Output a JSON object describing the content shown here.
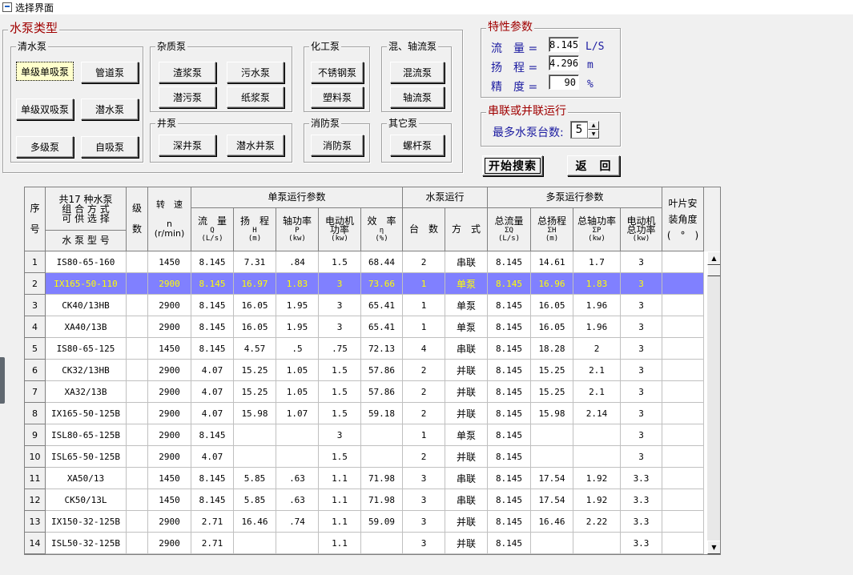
{
  "window": {
    "title": "选择界面"
  },
  "pump_type": {
    "legend": "水泵类型",
    "clean": {
      "legend": "清水泵",
      "buttons": [
        "单级单吸泵",
        "管道泵",
        "单级双吸泵",
        "潜水泵",
        "多级泵",
        "自吸泵"
      ]
    },
    "impurity": {
      "legend": "杂质泵",
      "buttons": [
        "渣浆泵",
        "污水泵",
        "潜污泵",
        "纸浆泵"
      ]
    },
    "chemical": {
      "legend": "化工泵",
      "buttons": [
        "不锈钢泵",
        "塑料泵"
      ]
    },
    "mixed": {
      "legend": "混、轴流泵",
      "buttons": [
        "混流泵",
        "轴流泵"
      ]
    },
    "well": {
      "legend": "井泵",
      "buttons": [
        "深井泵",
        "潜水井泵"
      ]
    },
    "fire": {
      "legend": "消防泵",
      "buttons": [
        "消防泵"
      ]
    },
    "other": {
      "legend": "其它泵",
      "buttons": [
        "螺杆泵"
      ]
    }
  },
  "characteristics": {
    "legend": "特性参数",
    "flow": {
      "label": "流　量 =",
      "value": "8.145",
      "unit": "L/S"
    },
    "head": {
      "label": "扬　程 =",
      "value": "4.296",
      "unit": "m"
    },
    "accuracy": {
      "label": "精　度 =",
      "value": "90",
      "unit": "%"
    }
  },
  "series_parallel": {
    "legend": "串联或并联运行",
    "max_label": "最多水泵台数:",
    "max_value": "5"
  },
  "actions": {
    "search": "开始搜索",
    "back": "返　回"
  },
  "table": {
    "headers": {
      "seq": "序\n\n号",
      "combo": "共17 种水泵\n组 合 方 式\n可 供 选 择",
      "model": "水 泵 型 号",
      "stage": "级\n\n数",
      "speed": "转　速\n\nn\n(r/min)",
      "single_group": "单泵运行参数",
      "flow": "流　量",
      "flow_sub": "Q\n(L/s)",
      "head": "扬　程",
      "head_sub": "H\n(m)",
      "shaft": "轴功率",
      "shaft_sub": "P\n(kw)",
      "motor": "电动机\n功率",
      "motor_sub": "(kw)",
      "eff": "效　率",
      "eff_sub": "η\n(%)",
      "run_group": "水泵运行",
      "count": "台　数",
      "mode": "方　式",
      "multi_group": "多泵运行参数",
      "tflow": "总流量",
      "tflow_sub": "ΣQ\n(L/s)",
      "thead": "总扬程",
      "thead_sub": "ΣH\n(m)",
      "tshaft": "总轴功率",
      "tshaft_sub": "ΣP\n(kw)",
      "tmotor": "电动机\n总功率",
      "tmotor_sub": "(kw)",
      "blade": "叶片安\n装角度\n(　°　)"
    },
    "rows": [
      [
        "1",
        "IS80-65-160",
        "",
        "1450",
        "8.145",
        "7.31",
        ".84",
        "1.5",
        "68.44",
        "2",
        "串联",
        "8.145",
        "14.61",
        "1.7",
        "3",
        ""
      ],
      [
        "2",
        "IX165-50-110",
        "",
        "2900",
        "8.145",
        "16.97",
        "1.83",
        "3",
        "73.66",
        "1",
        "单泵",
        "8.145",
        "16.96",
        "1.83",
        "3",
        ""
      ],
      [
        "3",
        "CK40/13HB",
        "",
        "2900",
        "8.145",
        "16.05",
        "1.95",
        "3",
        "65.41",
        "1",
        "单泵",
        "8.145",
        "16.05",
        "1.96",
        "3",
        ""
      ],
      [
        "4",
        "XA40/13B",
        "",
        "2900",
        "8.145",
        "16.05",
        "1.95",
        "3",
        "65.41",
        "1",
        "单泵",
        "8.145",
        "16.05",
        "1.96",
        "3",
        ""
      ],
      [
        "5",
        "IS80-65-125",
        "",
        "1450",
        "8.145",
        "4.57",
        ".5",
        ".75",
        "72.13",
        "4",
        "串联",
        "8.145",
        "18.28",
        "2",
        "3",
        ""
      ],
      [
        "6",
        "CK32/13HB",
        "",
        "2900",
        "4.07",
        "15.25",
        "1.05",
        "1.5",
        "57.86",
        "2",
        "并联",
        "8.145",
        "15.25",
        "2.1",
        "3",
        ""
      ],
      [
        "7",
        "XA32/13B",
        "",
        "2900",
        "4.07",
        "15.25",
        "1.05",
        "1.5",
        "57.86",
        "2",
        "并联",
        "8.145",
        "15.25",
        "2.1",
        "3",
        ""
      ],
      [
        "8",
        "IX165-50-125B",
        "",
        "2900",
        "4.07",
        "15.98",
        "1.07",
        "1.5",
        "59.18",
        "2",
        "并联",
        "8.145",
        "15.98",
        "2.14",
        "3",
        ""
      ],
      [
        "9",
        "ISL80-65-125B",
        "",
        "2900",
        "8.145",
        "",
        "",
        "3",
        "",
        "1",
        "单泵",
        "8.145",
        "",
        "",
        "3",
        ""
      ],
      [
        "10",
        "ISL65-50-125B",
        "",
        "2900",
        "4.07",
        "",
        "",
        "1.5",
        "",
        "2",
        "并联",
        "8.145",
        "",
        "",
        "3",
        ""
      ],
      [
        "11",
        "XA50/13",
        "",
        "1450",
        "8.145",
        "5.85",
        ".63",
        "1.1",
        "71.98",
        "3",
        "串联",
        "8.145",
        "17.54",
        "1.92",
        "3.3",
        ""
      ],
      [
        "12",
        "CK50/13L",
        "",
        "1450",
        "8.145",
        "5.85",
        ".63",
        "1.1",
        "71.98",
        "3",
        "串联",
        "8.145",
        "17.54",
        "1.92",
        "3.3",
        ""
      ],
      [
        "13",
        "IX150-32-125B",
        "",
        "2900",
        "2.71",
        "16.46",
        ".74",
        "1.1",
        "59.09",
        "3",
        "并联",
        "8.145",
        "16.46",
        "2.22",
        "3.3",
        ""
      ],
      [
        "14",
        "ISL50-32-125B",
        "",
        "2900",
        "2.71",
        "",
        "",
        "1.1",
        "",
        "3",
        "并联",
        "8.145",
        "",
        "",
        "3.3",
        ""
      ]
    ],
    "selected_row": 2
  },
  "colors": {
    "selected_row_bg": "#8080ff",
    "selected_row_fg": "#ffff00",
    "legend_red": "#a00000",
    "param_blue": "#1a1aa0"
  }
}
